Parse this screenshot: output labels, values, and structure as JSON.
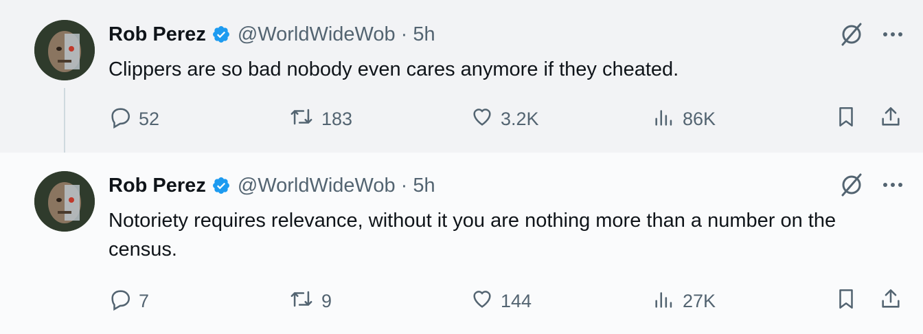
{
  "tweets": [
    {
      "author_name": "Rob Perez",
      "handle": "@WorldWideWob",
      "separator": "·",
      "time": "5h",
      "text": "Clippers are so bad nobody even cares anymore if they cheated.",
      "replies": "52",
      "retweets": "183",
      "likes": "3.2K",
      "views": "86K"
    },
    {
      "author_name": "Rob Perez",
      "handle": "@WorldWideWob",
      "separator": "·",
      "time": "5h",
      "text": "Notoriety requires relevance, without it you are nothing more than a number on the census.",
      "replies": "7",
      "retweets": "9",
      "likes": "144",
      "views": "27K"
    }
  ],
  "colors": {
    "verified_blue": "#1d9bf0",
    "muted_text": "#536471",
    "primary_text": "#0f1419",
    "highlight_bg": "#f2f3f5"
  },
  "icons": [
    "reply-icon",
    "retweet-icon",
    "like-icon",
    "views-icon",
    "bookmark-icon",
    "share-icon",
    "grok-icon",
    "more-icon",
    "verified-badge-icon"
  ]
}
